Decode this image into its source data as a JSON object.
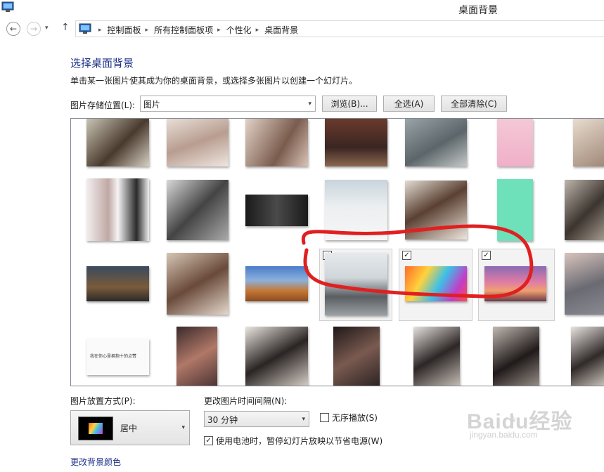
{
  "window": {
    "title": "桌面背景"
  },
  "navigation": {
    "back_glyph": "←",
    "forward_glyph": "→",
    "dropdown_glyph": "▾",
    "up_glyph": "↑",
    "breadcrumb": [
      "控制面板",
      "所有控制面板项",
      "个性化",
      "桌面背景"
    ],
    "separator": "▸"
  },
  "main": {
    "heading": "选择桌面背景",
    "description": "单击某一张图片使其成为你的桌面背景，或选择多张图片以创建一个幻灯片。",
    "location_label": "图片存储位置(L):",
    "location_value": "图片",
    "browse_label": "浏览(B)...",
    "select_all_label": "全选(A)",
    "clear_all_label": "全部清除(C)",
    "thumbnail_text": "我在你心里拥抱十的点赞",
    "checkmark": "✓"
  },
  "options": {
    "position_label": "图片放置方式(P):",
    "position_value": "居中",
    "interval_label": "更改图片时间间隔(N):",
    "interval_value": "30 分钟",
    "shuffle_label": "无序播放(S)",
    "shuffle_checked": false,
    "battery_label": "使用电池时，暂停幻灯片放映以节省电源(W)",
    "battery_checked": true,
    "bg_color_link": "更改背景颜色"
  },
  "watermark": {
    "brand": "Baidu经验",
    "url": "jingyan.baidu.com"
  },
  "colors": {
    "link": "#1e3287",
    "annotation": "#e02020"
  }
}
